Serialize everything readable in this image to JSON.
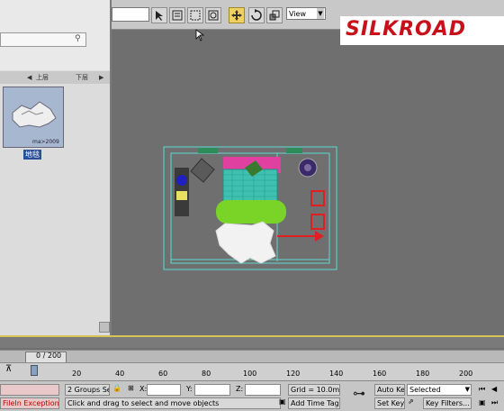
{
  "toolbar": {
    "view_dropdown": "View",
    "tools": [
      "select-icon",
      "select-by-name-icon",
      "rect-region-icon",
      "window-crossing-icon",
      "move-icon",
      "rotate-icon",
      "scale-icon"
    ]
  },
  "watermark": {
    "text": "SILKROAD"
  },
  "asset_browser": {
    "nav_up": "上层",
    "nav_next": "下层",
    "thumbnail_caption": "ma>2009",
    "thumbnail_label": "地毯"
  },
  "time_slider": {
    "frame": "0 / 200"
  },
  "ruler": {
    "ticks": [
      "20",
      "40",
      "60",
      "80",
      "100",
      "120",
      "140",
      "160",
      "180",
      "200"
    ]
  },
  "status": {
    "error": "FileIn Exception",
    "selection": "2 Groups Sele",
    "x_label": "X:",
    "y_label": "Y:",
    "z_label": "Z:",
    "grid": "Grid = 10.0mm",
    "prompt": "Click and drag to select and move objects",
    "add_time_tag": "Add Time Tag",
    "auto_key": "Auto Key",
    "selected": "Selected",
    "set_key": "Set Key",
    "key_filters": "Key Filters..."
  },
  "colors": {
    "viewport_bg": "#6f6f6f",
    "selection_cyan": "#5ed8d0",
    "active_tool": "#f0d060",
    "logo_red": "#c8101a"
  }
}
